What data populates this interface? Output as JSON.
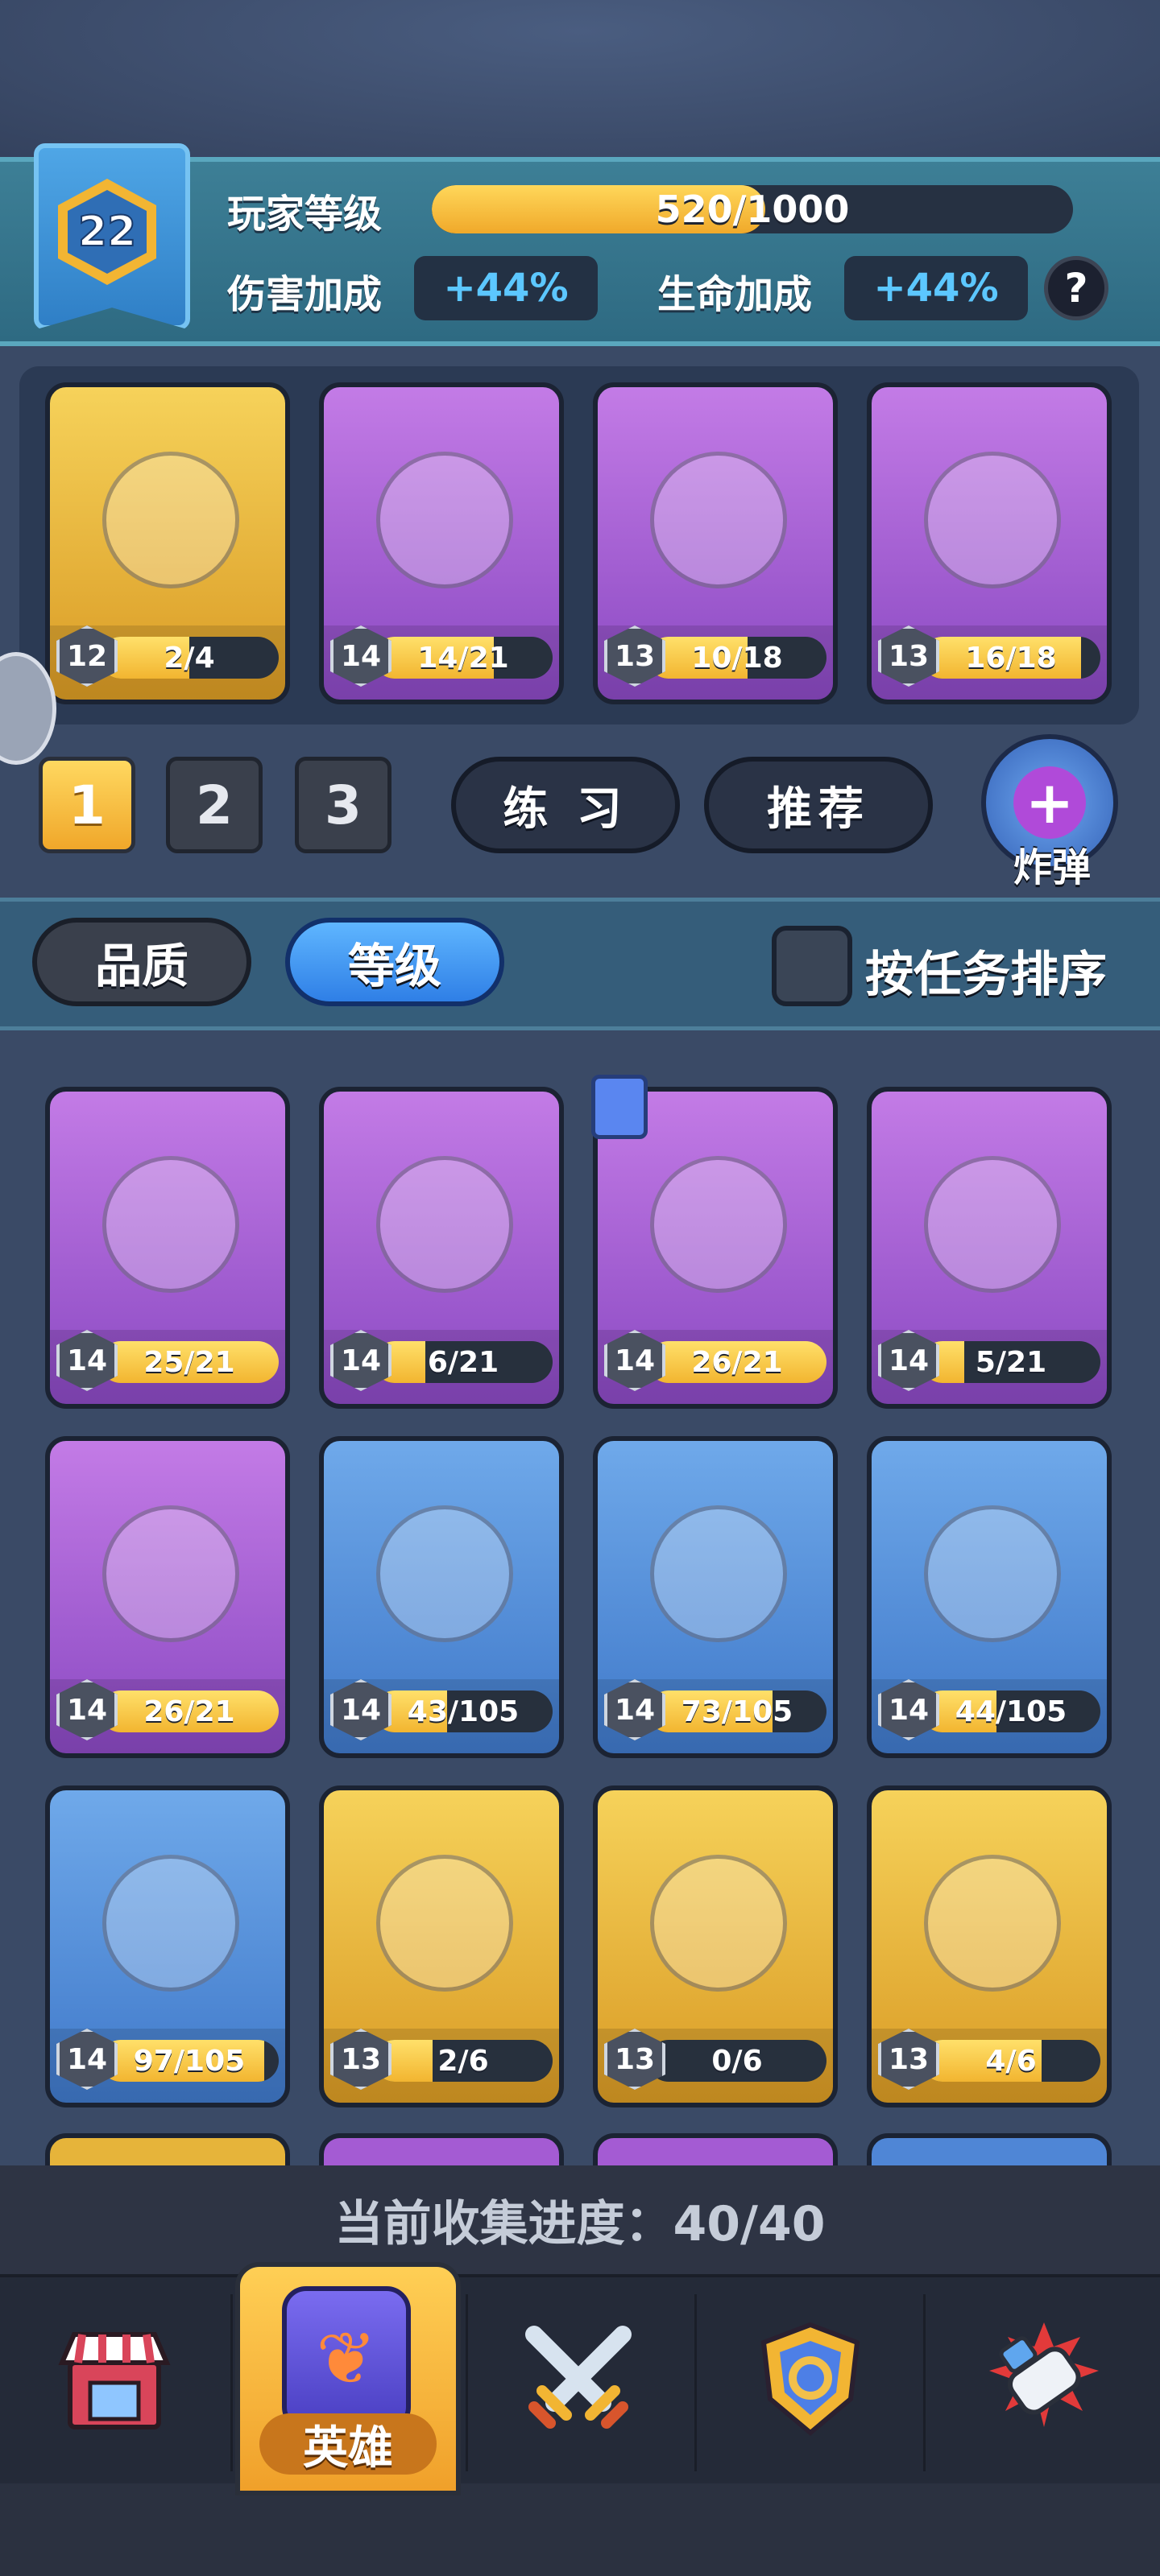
{
  "player": {
    "level": "22",
    "level_label": "玩家等级",
    "xp_text": "520/1000",
    "xp_fraction": 0.52,
    "damage_label": "伤害加成",
    "damage_value": "+44%",
    "health_label": "生命加成",
    "health_value": "+44%",
    "help_glyph": "?"
  },
  "deck": [
    {
      "level": "12",
      "progress": "2/4",
      "fraction": 0.5,
      "rarity": "gold"
    },
    {
      "level": "14",
      "progress": "14/21",
      "fraction": 0.67,
      "rarity": "purple"
    },
    {
      "level": "13",
      "progress": "10/18",
      "fraction": 0.56,
      "rarity": "purple"
    },
    {
      "level": "13",
      "progress": "16/18",
      "fraction": 0.89,
      "rarity": "purple"
    }
  ],
  "deck_slots": [
    "1",
    "2",
    "3"
  ],
  "active_slot": 0,
  "actions": {
    "practice": "练 习",
    "recommend": "推荐",
    "bomb_label": "炸弹"
  },
  "filters": {
    "quality": "品质",
    "level": "等级",
    "sort_by_task": "按任务排序"
  },
  "collection": [
    {
      "level": "14",
      "progress": "25/21",
      "fraction": 1.0,
      "rarity": "purple"
    },
    {
      "level": "14",
      "progress": "6/21",
      "fraction": 0.29,
      "rarity": "purple"
    },
    {
      "level": "14",
      "progress": "26/21",
      "fraction": 1.0,
      "rarity": "purple"
    },
    {
      "level": "14",
      "progress": "5/21",
      "fraction": 0.24,
      "rarity": "purple"
    },
    {
      "level": "14",
      "progress": "26/21",
      "fraction": 1.0,
      "rarity": "purple"
    },
    {
      "level": "14",
      "progress": "43/105",
      "fraction": 0.41,
      "rarity": "blue"
    },
    {
      "level": "14",
      "progress": "73/105",
      "fraction": 0.7,
      "rarity": "blue"
    },
    {
      "level": "14",
      "progress": "44/105",
      "fraction": 0.42,
      "rarity": "blue"
    },
    {
      "level": "14",
      "progress": "97/105",
      "fraction": 0.92,
      "rarity": "blue"
    },
    {
      "level": "13",
      "progress": "2/6",
      "fraction": 0.33,
      "rarity": "gold"
    },
    {
      "level": "13",
      "progress": "0/6",
      "fraction": 0.0,
      "rarity": "gold"
    },
    {
      "level": "13",
      "progress": "4/6",
      "fraction": 0.67,
      "rarity": "gold"
    }
  ],
  "collection_progress": "当前收集进度：40/40",
  "nav": {
    "shop_icon": "shop-icon",
    "heroes_label": "英雄",
    "battle_icon": "crossed-swords-icon",
    "clan_icon": "shield-emblem-icon",
    "events_icon": "gauntlet-icon"
  }
}
